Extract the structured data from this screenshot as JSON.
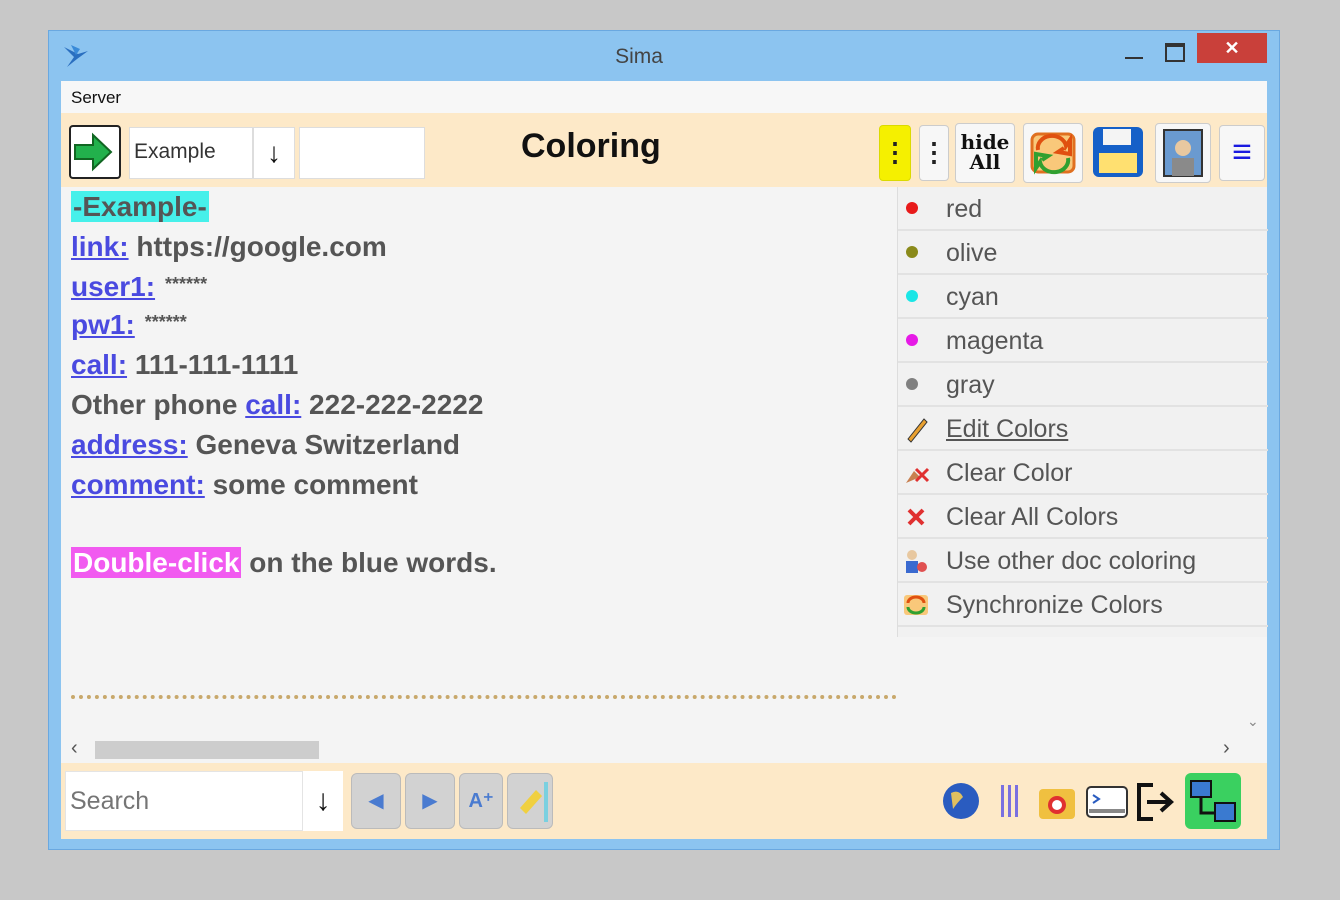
{
  "window": {
    "title": "Sima",
    "close_glyph": "✕"
  },
  "menubar": {
    "server": "Server"
  },
  "toolbar": {
    "doc_select": "Example",
    "select_arrow": "↓",
    "page_title": "Coloring",
    "color_menu_glyph": "⋮",
    "more_glyph": "⋮",
    "hide_all_line1": "hide",
    "hide_all_line2": "All",
    "hamburger_glyph": "≡"
  },
  "document": {
    "heading": "-Example-",
    "link_label": "link:",
    "link_value": "https://google.com",
    "user_label": "user1:",
    "user_value": "******",
    "pw_label": "pw1:",
    "pw_value": "******",
    "call_label": "call:",
    "call_value": "111-111-1111",
    "other_phone_prefix": "Other phone",
    "call2_label": "call:",
    "call2_value": "222-222-2222",
    "address_label": "address:",
    "address_value": "Geneva Switzerland",
    "comment_label": "comment:",
    "comment_value": "some comment",
    "instruction_highlight": "Double-click",
    "instruction_rest": "on the blue words."
  },
  "color_menu": {
    "items": [
      {
        "label": "red",
        "icon": "dot-icon",
        "color": "#e81a1a"
      },
      {
        "label": "olive",
        "icon": "dot-icon",
        "color": "#8a8a1a"
      },
      {
        "label": "cyan",
        "icon": "dot-icon",
        "color": "#1ae6e6"
      },
      {
        "label": "magenta",
        "icon": "dot-icon",
        "color": "#e61ae6"
      },
      {
        "label": "gray",
        "icon": "dot-icon",
        "color": "#808080"
      },
      {
        "label": "Edit Colors",
        "icon": "pencil-icon"
      },
      {
        "label": "Clear Color",
        "icon": "brush-x-icon"
      },
      {
        "label": "Clear All Colors",
        "icon": "x-icon"
      },
      {
        "label": "Use other doc coloring",
        "icon": "users-icon"
      },
      {
        "label": "Synchronize Colors",
        "icon": "sync-icon"
      }
    ]
  },
  "scroll": {
    "left_glyph": "‹",
    "right_glyph": "›",
    "down_glyph": "⌄"
  },
  "bottombar": {
    "search_placeholder": "Search",
    "search_arrow": "↓",
    "prev_glyph": "◀",
    "next_glyph": "▶",
    "font_size_label": "A⁺"
  },
  "colors": {
    "toolbar_bg": "#fde9c8",
    "link": "#4a4ae0",
    "heading_highlight": "#46f0ea",
    "instruction_highlight": "#f15af0",
    "close": "#c9403a"
  }
}
